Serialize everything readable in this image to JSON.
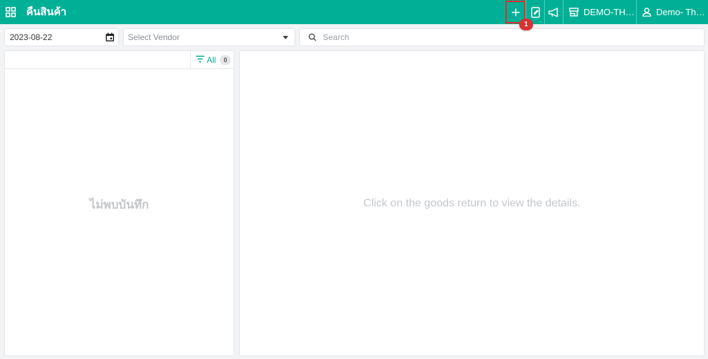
{
  "header": {
    "title": "คืนสินค้า",
    "background": "#00b096",
    "add_badge": "1",
    "store_label": "DEMO-THAILAND",
    "user_label": "Demo- Thailand"
  },
  "filters": {
    "date_value": "2023-08-22",
    "vendor_placeholder": "Select Vendor",
    "search_placeholder": "Search"
  },
  "list": {
    "filter_label": "All",
    "count": "0",
    "empty_text": "ไม่พบบันทึก"
  },
  "detail": {
    "empty_text": "Click on the goods return to view the details."
  },
  "icons": [
    "grid-menu-icon",
    "plus-icon",
    "phone-edit-icon",
    "megaphone-icon",
    "store-icon",
    "user-icon",
    "calendar-icon",
    "caret-down-icon",
    "search-icon",
    "filter-icon"
  ]
}
